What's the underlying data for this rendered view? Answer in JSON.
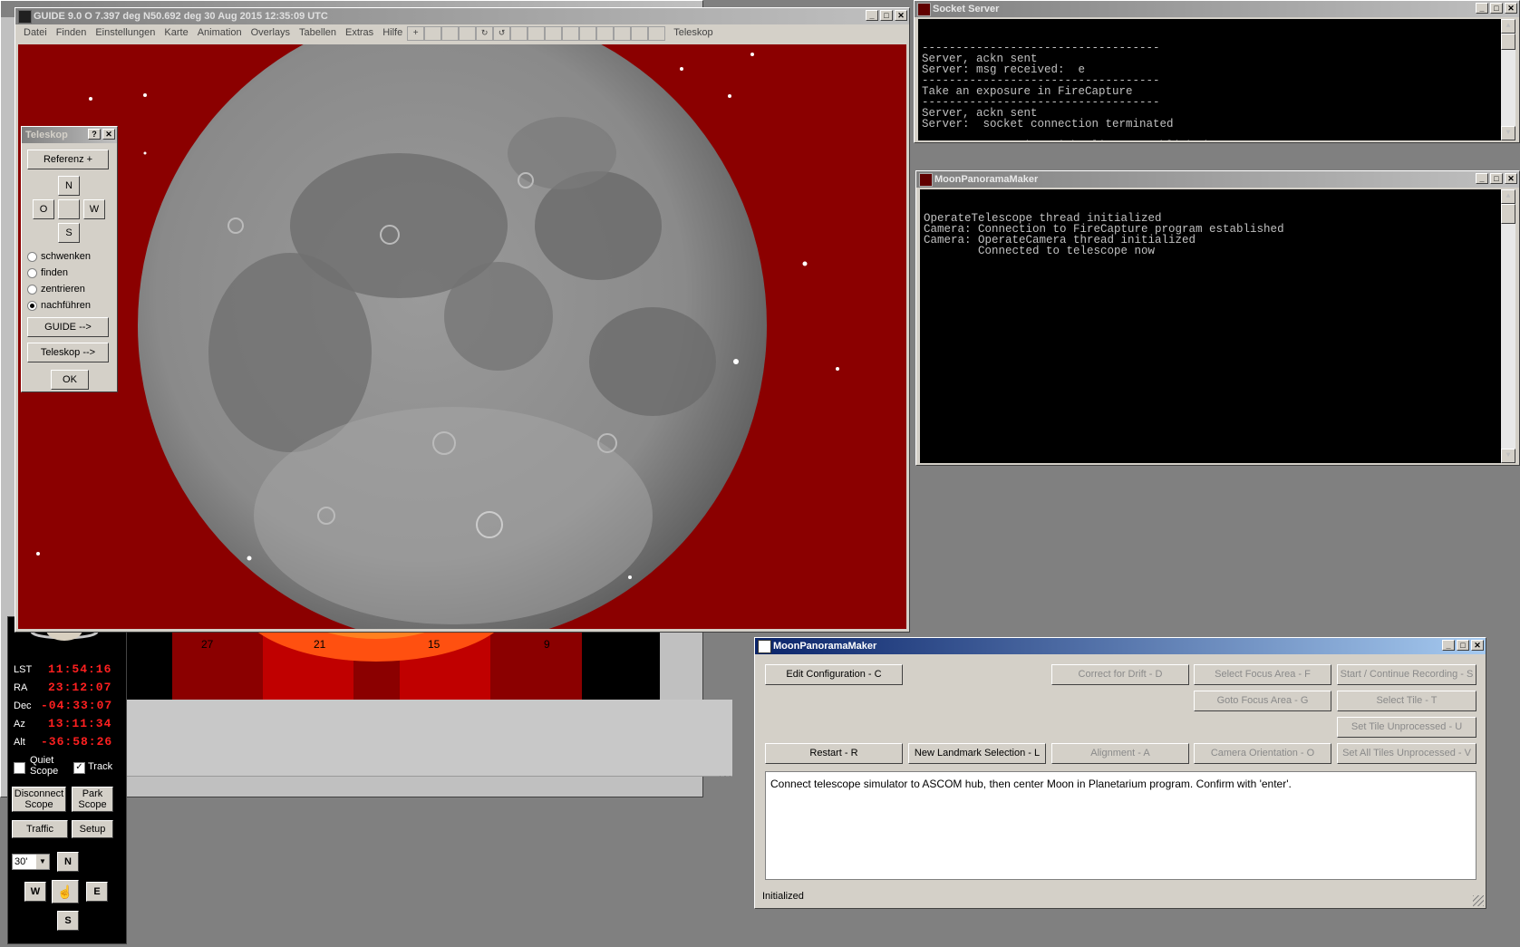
{
  "guide": {
    "title": "GUIDE 9.0   O  7.397 deg N50.692 deg    30 Aug 2015 12:35:09 UTC",
    "menu": [
      "Datei",
      "Finden",
      "Einstellungen",
      "Karte",
      "Animation",
      "Overlays",
      "Tabellen",
      "Extras",
      "Hilfe"
    ],
    "telescope_menu": "Teleskop",
    "background_color": "#8b0000"
  },
  "telescope_dialog": {
    "title": "Teleskop",
    "help": "?",
    "close": "✕",
    "referenz": "Referenz +",
    "dir_n": "N",
    "dir_o": "O",
    "dir_w": "W",
    "dir_s": "S",
    "modes": [
      "schwenken",
      "finden",
      "zentrieren",
      "nachführen"
    ],
    "guide_btn": "GUIDE -->",
    "teleskop_btn": "Teleskop -->",
    "ok": "OK"
  },
  "socket_server": {
    "title": "Socket Server",
    "text": "-----------------------------------\nServer, ackn sent\nServer: msg received:  e\n-----------------------------------\nTake an exposure in FireCapture\n-----------------------------------\nServer, ackn sent\nServer:  socket connection terminated\n\nServer: connection with client established"
  },
  "mpm_console": {
    "title": "MoonPanoramaMaker",
    "text": "OperateTelescope thread initialized\nCamera: Connection to FireCapture program established\nCamera: OperateCamera thread initialized\n        Connected to telescope now"
  },
  "scope_panel": {
    "labels": [
      "LST",
      "RA",
      "Dec",
      "Az",
      "Alt"
    ],
    "values": [
      "11:54:16",
      "23:12:07",
      "-04:33:07",
      "13:11:34",
      "-36:58:26"
    ],
    "quiet_scope": "Quiet\nScope",
    "track": "Track",
    "disconnect": "Disconnect\nScope",
    "park": "Park\nScope",
    "traffic": "Traffic",
    "setup": "Setup",
    "rate": "30'",
    "n": "N",
    "w": "W",
    "e": "E",
    "s": "S"
  },
  "timeline": {
    "ticks": [
      "27",
      "21",
      "15",
      "9"
    ]
  },
  "mpm_gui": {
    "title": "MoonPanoramaMaker",
    "edit_config": "Edit Configuration - C",
    "correct_drift": "Correct for Drift - D",
    "select_focus": "Select Focus Area - F",
    "start_recording": "Start / Continue Recording - S",
    "goto_focus": "Goto Focus Area - G",
    "select_tile": "Select Tile - T",
    "set_tile_unprocessed": "Set Tile Unprocessed - U",
    "restart": "Restart - R",
    "new_landmark": "New Landmark Selection - L",
    "alignment": "Alignment - A",
    "camera_orientation": "Camera Orientation - O",
    "set_all_unprocessed": "Set All Tiles Unprocessed - V",
    "message": "Connect telescope simulator to ASCOM hub, then center Moon in Planetarium program. Confirm with 'enter'.",
    "status": "Initialized"
  }
}
